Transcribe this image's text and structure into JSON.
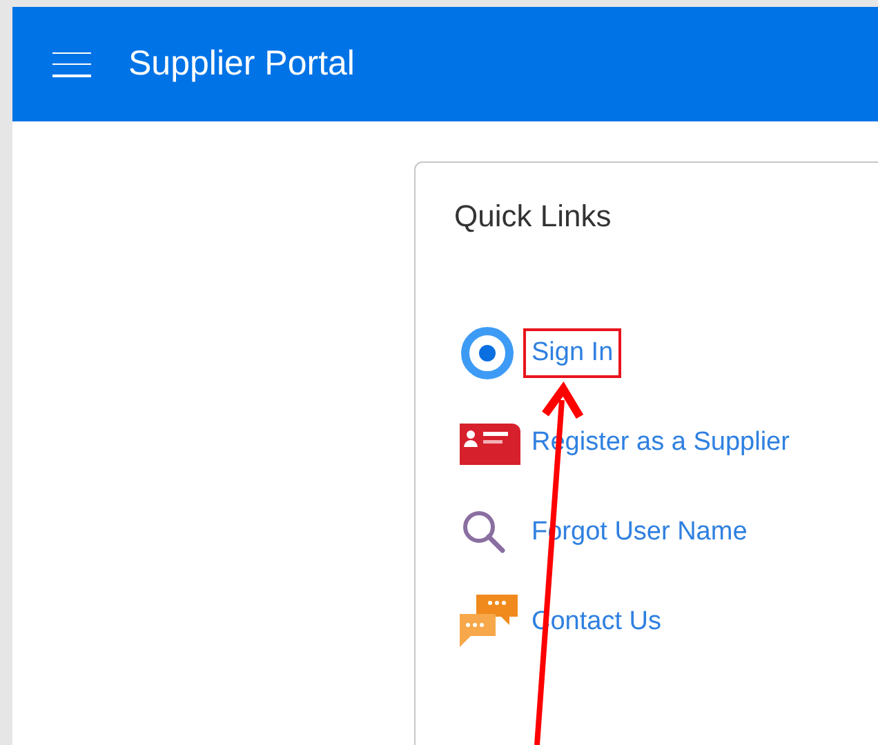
{
  "header": {
    "title": "Supplier Portal"
  },
  "card": {
    "title": "Quick Links",
    "links": [
      {
        "kind": "target",
        "label": "Sign In",
        "highlighted": true
      },
      {
        "kind": "card",
        "label": "Register as a Supplier",
        "highlighted": false
      },
      {
        "kind": "search",
        "label": "Forgot User Name",
        "highlighted": false
      },
      {
        "kind": "chat",
        "label": "Contact Us",
        "highlighted": false
      }
    ]
  }
}
